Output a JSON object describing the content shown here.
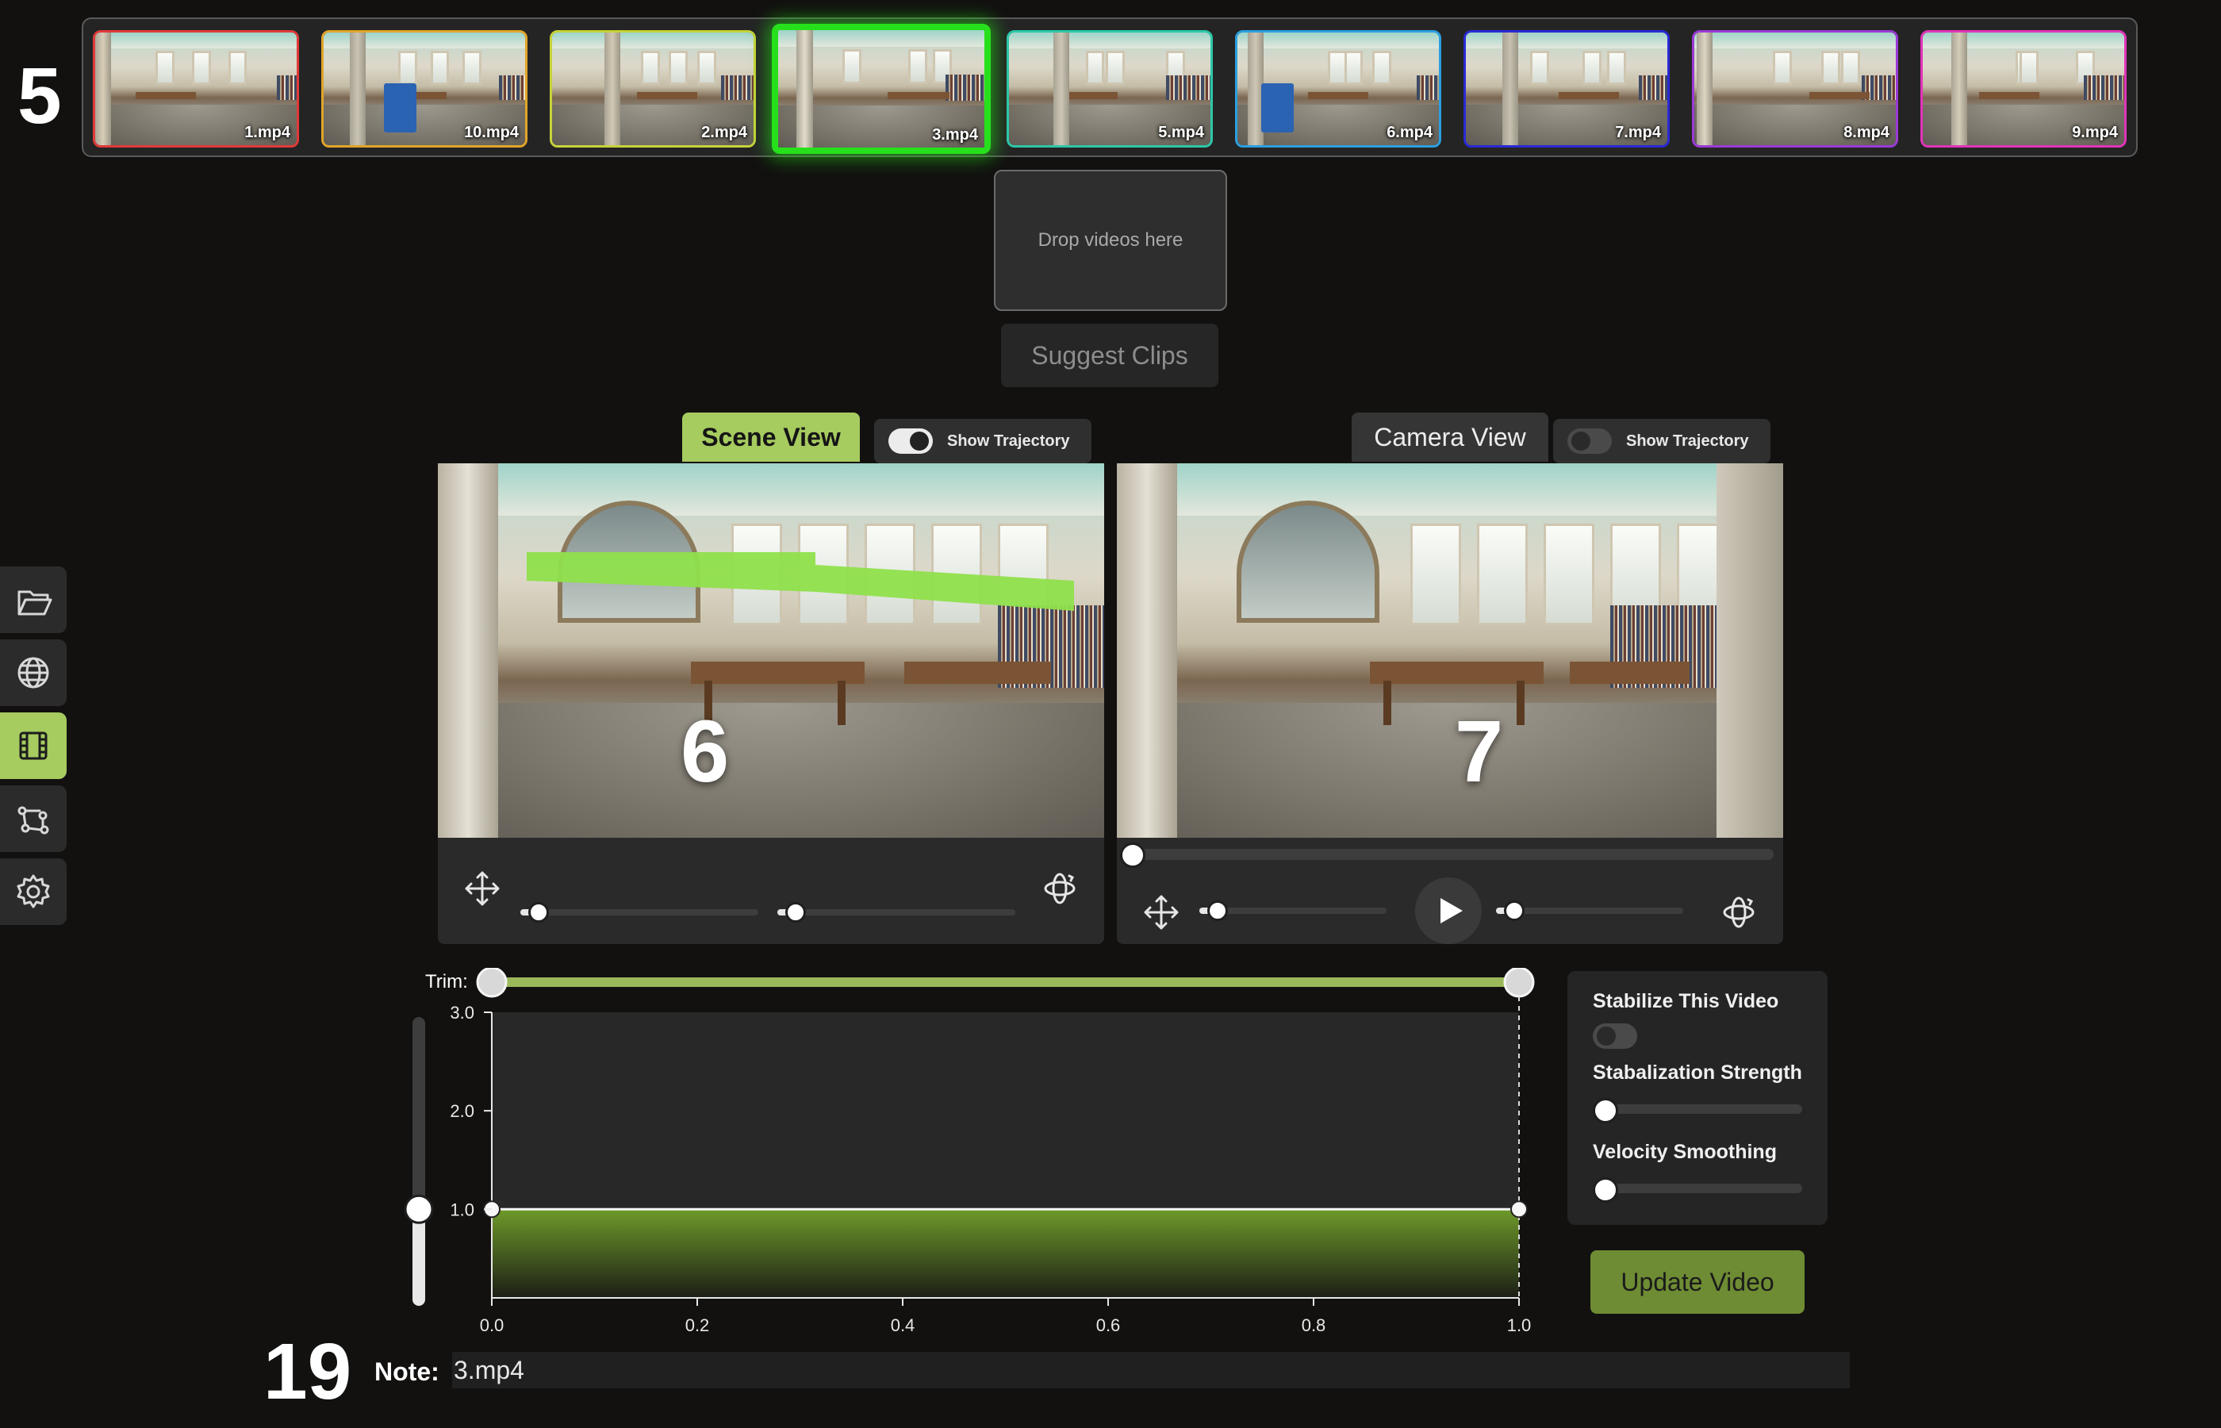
{
  "annotations": {
    "a1": "5",
    "a2": "6",
    "a3": "7",
    "a4": "19"
  },
  "clips": [
    {
      "label": "1.mp4",
      "color": "#e03a3a",
      "selected": false
    },
    {
      "label": "10.mp4",
      "color": "#e0a52a",
      "selected": false
    },
    {
      "label": "2.mp4",
      "color": "#c6d23a",
      "selected": false
    },
    {
      "label": "3.mp4",
      "color": "#27e01c",
      "selected": true
    },
    {
      "label": "5.mp4",
      "color": "#2cc7a8",
      "selected": false
    },
    {
      "label": "6.mp4",
      "color": "#2b9fe0",
      "selected": false
    },
    {
      "label": "7.mp4",
      "color": "#2a2ad6",
      "selected": false
    },
    {
      "label": "8.mp4",
      "color": "#9a3ad6",
      "selected": false
    },
    {
      "label": "9.mp4",
      "color": "#e034b8",
      "selected": false
    }
  ],
  "dropzone": {
    "text": "Drop videos here"
  },
  "suggest_button": "Suggest Clips",
  "scene_view": {
    "tab_label": "Scene View",
    "trajectory_label": "Show Trajectory",
    "trajectory_on": true
  },
  "camera_view": {
    "tab_label": "Camera View",
    "trajectory_label": "Show Trajectory",
    "trajectory_on": false
  },
  "sidebar": [
    {
      "icon": "folder-open-icon",
      "active": false
    },
    {
      "icon": "globe-icon",
      "active": false
    },
    {
      "icon": "film-icon",
      "active": true
    },
    {
      "icon": "graph-nodes-icon",
      "active": false
    },
    {
      "icon": "gear-icon",
      "active": false
    }
  ],
  "trim": {
    "label": "Trim:",
    "start": 0.0,
    "end": 1.0
  },
  "speed_chart": {
    "type": "area",
    "x_ticks": [
      "0.0",
      "0.2",
      "0.4",
      "0.6",
      "0.8",
      "1.0"
    ],
    "y_ticks": [
      "1.0",
      "2.0",
      "3.0"
    ],
    "ylim": [
      0.1,
      3.0
    ],
    "points": [
      [
        0.0,
        1.0
      ],
      [
        1.0,
        1.0
      ]
    ]
  },
  "chart_data": {
    "type": "area",
    "x": [
      0.0,
      1.0
    ],
    "values": [
      1.0,
      1.0
    ],
    "xlim": [
      0.0,
      1.0
    ],
    "ylim": [
      0.1,
      3.0
    ],
    "x_ticks": [
      "0.0",
      "0.2",
      "0.4",
      "0.6",
      "0.8",
      "1.0"
    ],
    "y_ticks": [
      "1.0",
      "2.0",
      "3.0"
    ],
    "title": "",
    "xlabel": "",
    "ylabel": "",
    "color": "#6e9a2a"
  },
  "settings": {
    "stabilize_label": "Stabilize This Video",
    "stabilize_on": false,
    "strength_label": "Stabalization Strength",
    "strength_value": 0.0,
    "smoothing_label": "Velocity Smoothing",
    "smoothing_value": 0.0
  },
  "update_button": "Update Video",
  "note": {
    "label": "Note:",
    "value": "3.mp4"
  },
  "colors": {
    "accent": "#a6cb5f",
    "selected_clip": "#27e01c",
    "background": "#121110"
  }
}
